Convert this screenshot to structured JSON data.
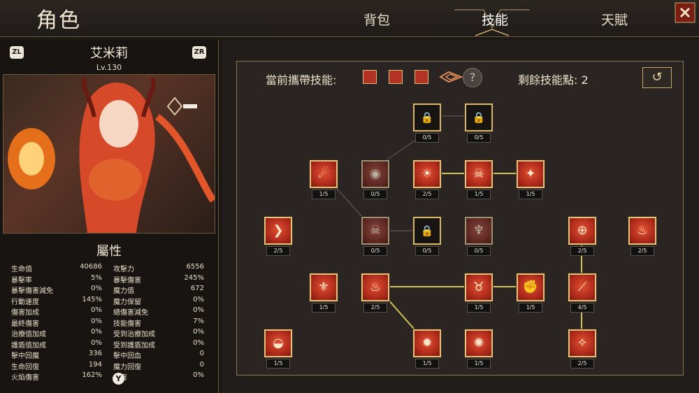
{
  "header": {
    "title": "角色",
    "tabs": [
      {
        "label": "背包",
        "active": false
      },
      {
        "label": "技能",
        "active": true
      },
      {
        "label": "天賦",
        "active": false
      }
    ],
    "close_icon": "close-x-icon"
  },
  "character": {
    "prev_button": "ZL",
    "next_button": "ZR",
    "name": "艾米莉",
    "level": "Lv.130"
  },
  "attributes": {
    "title": "屬性",
    "left": [
      {
        "label": "生命值",
        "value": "40686"
      },
      {
        "label": "暴擊率",
        "value": "5%"
      },
      {
        "label": "暴擊傷害減免",
        "value": "0%"
      },
      {
        "label": "行動速度",
        "value": "145%"
      },
      {
        "label": "傷害加成",
        "value": "0%"
      },
      {
        "label": "最終傷害",
        "value": "0%"
      },
      {
        "label": "治療值加成",
        "value": "0%"
      },
      {
        "label": "護盾值加成",
        "value": "0%"
      },
      {
        "label": "擊中回魔",
        "value": "336"
      },
      {
        "label": "生命回復",
        "value": "194"
      },
      {
        "label": "火焰傷害",
        "value": "162%"
      }
    ],
    "right": [
      {
        "label": "攻擊力",
        "value": "6556"
      },
      {
        "label": "暴擊傷害",
        "value": "245%"
      },
      {
        "label": "魔力值",
        "value": "672"
      },
      {
        "label": "魔力保留",
        "value": "0%"
      },
      {
        "label": "總傷害減免",
        "value": "0%"
      },
      {
        "label": "技能傷害",
        "value": "7%"
      },
      {
        "label": "受到治療加成",
        "value": "0%"
      },
      {
        "label": "受到護盾加成",
        "value": "0%"
      },
      {
        "label": "擊中回血",
        "value": "0"
      },
      {
        "label": "魔力回復",
        "value": "0"
      },
      {
        "label": "傷害",
        "value": "0%"
      }
    ],
    "y_button": "Y"
  },
  "skills": {
    "equipped_label": "當前攜帶技能:",
    "remaining_label": "剩餘技能點:",
    "remaining_value": "2",
    "help_symbol": "?",
    "reset_icon": "reset-icon",
    "equipped_icons": [
      "fire-slash-icon",
      "fire-claw-icon",
      "fire-orb-icon"
    ],
    "nodes": [
      {
        "id": "lock-1",
        "level": "0/5",
        "icon": "lock-icon",
        "locked": true
      },
      {
        "id": "lock-2",
        "level": "0/5",
        "icon": "lock-icon",
        "locked": true
      },
      {
        "id": "fire-orb",
        "level": "1/5",
        "icon": "fire-orb-icon"
      },
      {
        "id": "eye",
        "level": "0/5",
        "icon": "eye-icon"
      },
      {
        "id": "sun",
        "level": "2/5",
        "icon": "sun-icon"
      },
      {
        "id": "bunny-skull",
        "level": "1/5",
        "icon": "horned-skull-icon"
      },
      {
        "id": "phoenix",
        "level": "1/5",
        "icon": "phoenix-icon"
      },
      {
        "id": "fire-slash",
        "level": "2/5",
        "icon": "fire-slash-icon"
      },
      {
        "id": "skull",
        "level": "0/5",
        "icon": "skull-icon"
      },
      {
        "id": "lock-3",
        "level": "0/5",
        "icon": "lock-icon",
        "locked": true
      },
      {
        "id": "horned-helm",
        "level": "0/5",
        "icon": "helm-icon"
      },
      {
        "id": "rune-circle",
        "level": "2/5",
        "icon": "rune-circle-icon"
      },
      {
        "id": "fire-demon",
        "level": "2/5",
        "icon": "fire-demon-icon"
      },
      {
        "id": "fleur",
        "level": "1/5",
        "icon": "fleur-icon"
      },
      {
        "id": "flame",
        "level": "2/5",
        "icon": "flame-icon"
      },
      {
        "id": "demon-face",
        "level": "1/5",
        "icon": "demon-face-icon"
      },
      {
        "id": "fire-fist",
        "level": "1/5",
        "icon": "fire-fist-icon"
      },
      {
        "id": "fire-claw",
        "level": "4/5",
        "icon": "fire-claw-icon"
      },
      {
        "id": "bowl",
        "level": "1/5",
        "icon": "bowl-icon"
      },
      {
        "id": "explosion",
        "level": "1/5",
        "icon": "explosion-icon"
      },
      {
        "id": "mace",
        "level": "1/5",
        "icon": "mace-icon"
      },
      {
        "id": "sparkles",
        "level": "2/5",
        "icon": "sparkles-icon"
      }
    ]
  }
}
